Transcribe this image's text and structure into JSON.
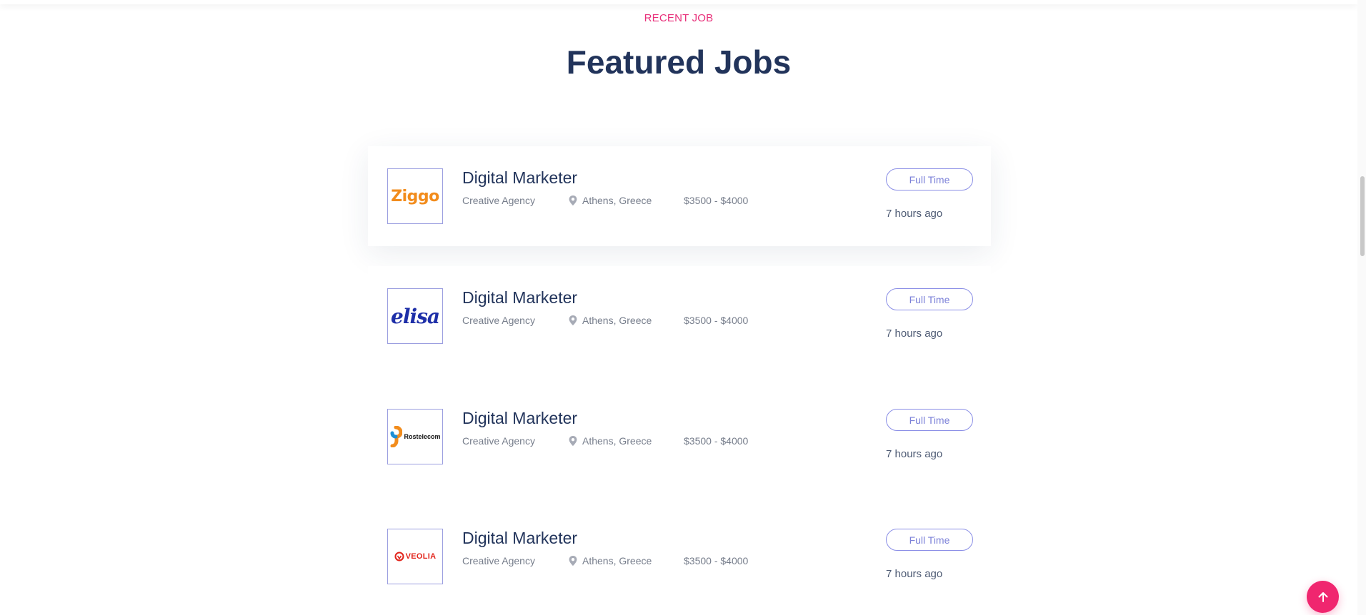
{
  "section": {
    "eyebrow": "RECENT JOB",
    "title": "Featured Jobs"
  },
  "jobs": [
    {
      "logo_text": "Ziggo",
      "title": "Digital Marketer",
      "company": "Creative Agency",
      "location": "Athens, Greece",
      "salary": "$3500 - $4000",
      "type": "Full Time",
      "posted": "7 hours ago"
    },
    {
      "logo_text": "elisa",
      "title": "Digital Marketer",
      "company": "Creative Agency",
      "location": "Athens, Greece",
      "salary": "$3500 - $4000",
      "type": "Full Time",
      "posted": "7 hours ago"
    },
    {
      "logo_text": "Rostelecom",
      "title": "Digital Marketer",
      "company": "Creative Agency",
      "location": "Athens, Greece",
      "salary": "$3500 - $4000",
      "type": "Full Time",
      "posted": "7 hours ago"
    },
    {
      "logo_text": "VEOLIA",
      "title": "Digital Marketer",
      "company": "Creative Agency",
      "location": "Athens, Greece",
      "salary": "$3500 - $4000",
      "type": "Full Time",
      "posted": "7 hours ago"
    }
  ],
  "icons": {
    "location": "map-pin-icon",
    "back_to_top": "arrow-up-icon"
  },
  "colors": {
    "accent": "#e8307a",
    "heading": "#22345b",
    "badge_border": "#8a8ee6",
    "back_to_top": "#f0266f"
  }
}
